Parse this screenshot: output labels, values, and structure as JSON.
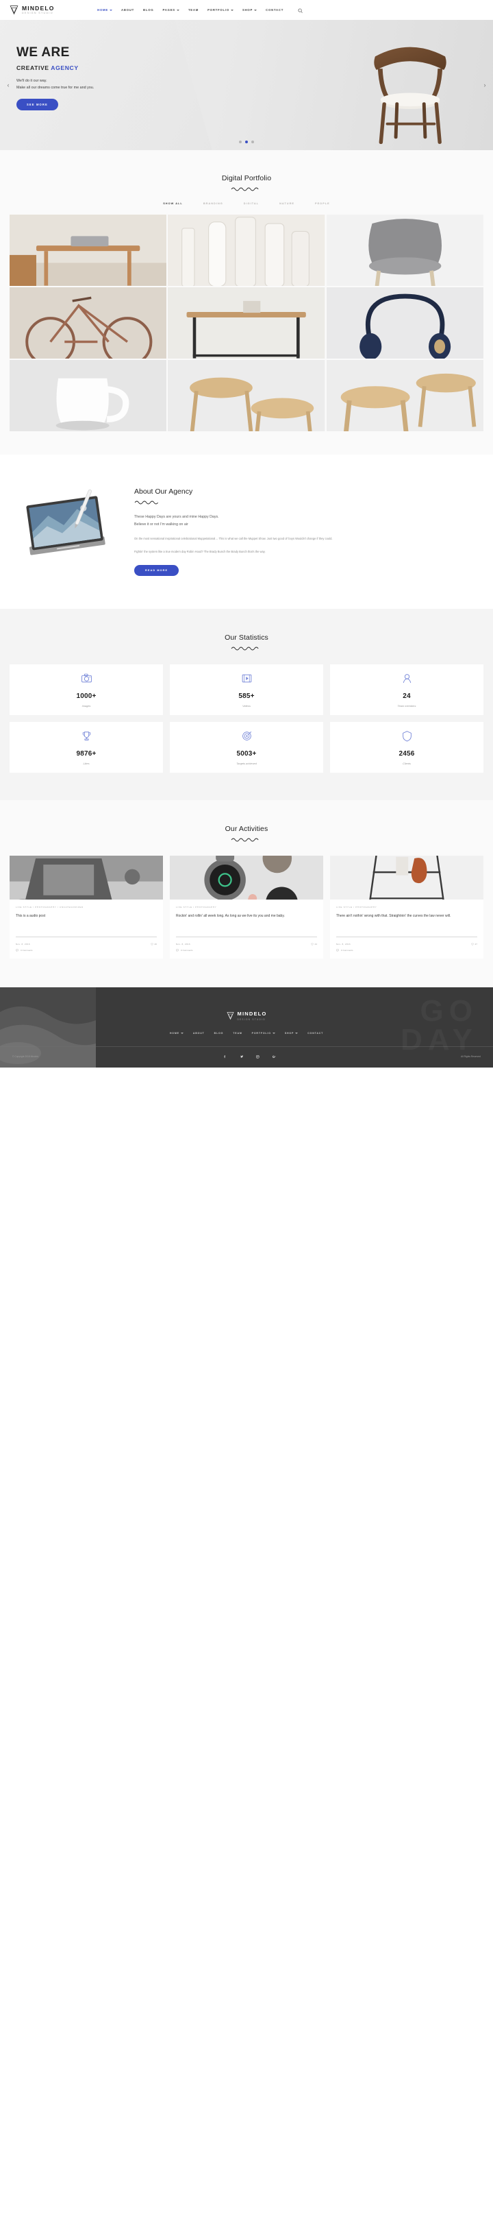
{
  "brand": {
    "name": "MINDELO",
    "tagline": "DESIGN STUDIO"
  },
  "nav": {
    "items": [
      {
        "label": "HOME",
        "caret": true,
        "active": true
      },
      {
        "label": "ABOUT",
        "caret": false,
        "active": false
      },
      {
        "label": "BLOG",
        "caret": false,
        "active": false
      },
      {
        "label": "PAGES",
        "caret": true,
        "active": false
      },
      {
        "label": "TEAM",
        "caret": false,
        "active": false
      },
      {
        "label": "PORTFOLIO",
        "caret": true,
        "active": false
      },
      {
        "label": "SHOP",
        "caret": true,
        "active": false
      },
      {
        "label": "CONTACT",
        "caret": false,
        "active": false
      }
    ],
    "search_icon": "search-icon"
  },
  "hero": {
    "line1": "WE ARE",
    "line2_plain": "CREATIVE ",
    "line2_accent": "AGENCY",
    "para1": "We'll do it our way.",
    "para2": "Make all our dreams come true for me and you.",
    "button": "SEE MORE",
    "prev_icon": "chevron-left-icon",
    "next_icon": "chevron-right-icon",
    "slides": 3,
    "active_slide": 2,
    "accent_color": "#3a4fc4"
  },
  "portfolio": {
    "title": "Digital Portfolio",
    "filters": [
      {
        "label": "SHOW ALL",
        "active": true
      },
      {
        "label": "BRANDING",
        "active": false
      },
      {
        "label": "DIGITAL",
        "active": false
      },
      {
        "label": "NATURE",
        "active": false
      },
      {
        "label": "PEOPLE",
        "active": false
      }
    ],
    "items": [
      {
        "name": "wooden-desk-with-laptop"
      },
      {
        "name": "cosmetic-bottles-set"
      },
      {
        "name": "grey-upholstered-chair"
      },
      {
        "name": "vintage-bicycle"
      },
      {
        "name": "minimal-console-table"
      },
      {
        "name": "navy-headphones"
      },
      {
        "name": "white-ceramic-mug"
      },
      {
        "name": "round-wooden-stools"
      },
      {
        "name": "wooden-stool-pair"
      }
    ]
  },
  "about": {
    "title": "About Our Agency",
    "lead_line1": "These Happy Days are yours and mine Happy Days.",
    "lead_line2": "Believe it or not I'm walking on air",
    "copy1": "On the most sensational inspirational celebrational Muppetational… This is what we call the Muppet Show. Just two good ol' boys Wouldn't change if they could.",
    "copy2": "Fightin' the system like a true modern day Robin Hood? The Brady Bunch the Brady Bunch that's the way.",
    "button": "READ MORE",
    "image_name": "tablet-with-stylus-photo"
  },
  "stats": {
    "title": "Our Statistics",
    "cards": [
      {
        "icon": "camera-icon",
        "value": "1000+",
        "label": "Images"
      },
      {
        "icon": "video-film-icon",
        "value": "585+",
        "label": "Videos"
      },
      {
        "icon": "user-icon",
        "value": "24",
        "label": "Team members"
      },
      {
        "icon": "trophy-icon",
        "value": "9876+",
        "label": "Likes"
      },
      {
        "icon": "target-icon",
        "value": "5003+",
        "label": "Targets achieved"
      },
      {
        "icon": "shield-icon",
        "value": "2456",
        "label": "Clients"
      }
    ],
    "icon_color": "#6d7fd6"
  },
  "blog": {
    "title": "Our Activities",
    "posts": [
      {
        "image_name": "laptop-workspace-bw-photo",
        "categories": "LIFE STYLE  /  PHOTOGRAPHY  /  UNCATEGORIZED",
        "title": "This is a audio post",
        "date": "Nov. 8, 2016",
        "likes": "26",
        "comments": "0 Comments"
      },
      {
        "image_name": "smart-watches-photo",
        "categories": "LIFE STYLE  /  PHOTOGRAPHY",
        "title": "Rockin' and rollin' all week long. As long as we live its you and me baby.",
        "date": "Nov. 8, 2016",
        "likes": "24",
        "comments": "0 Comments"
      },
      {
        "image_name": "clothing-rack-photo",
        "categories": "LIFE STYLE  /  PHOTOGRAPHY",
        "title": "There ain't nothin' wrong with that. Straightnin' the curves the law never will.",
        "date": "Nov. 8, 2016",
        "likes": "27",
        "comments": "0 Comments"
      }
    ]
  },
  "footer": {
    "brand_name": "MINDELO",
    "brand_sub": "DESIGN STUDIO",
    "ghost_text_line1": "GO",
    "ghost_text_line2": "DAY",
    "nav": [
      {
        "label": "HOME",
        "caret": true
      },
      {
        "label": "ABOUT",
        "caret": false
      },
      {
        "label": "BLOG",
        "caret": false
      },
      {
        "label": "TEAM",
        "caret": false
      },
      {
        "label": "PORTFOLIO",
        "caret": true
      },
      {
        "label": "SHOP",
        "caret": true
      },
      {
        "label": "CONTACT",
        "caret": false
      }
    ],
    "copyright": "© Copyright 2018 Mindelo",
    "rights": "All Rights Reserved",
    "social": [
      {
        "icon": "facebook-icon",
        "glyph": "f"
      },
      {
        "icon": "twitter-icon",
        "glyph": "t"
      },
      {
        "icon": "instagram-icon",
        "glyph": "i"
      },
      {
        "icon": "google-plus-icon",
        "glyph": "g"
      }
    ]
  }
}
